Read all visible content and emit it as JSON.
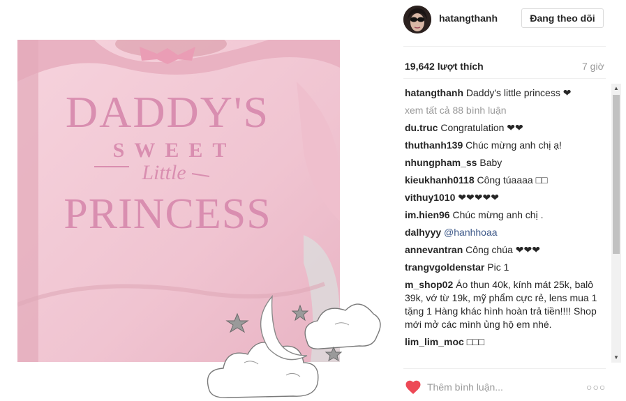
{
  "post": {
    "image_print": {
      "line1": "DADDY'S",
      "line2": "SWEET",
      "line3": "Little",
      "line4": "PRINCESS"
    }
  },
  "header": {
    "username": "hatangthanh",
    "follow_label": "Đang theo dõi"
  },
  "stats": {
    "likes": "19,642 lượt thích",
    "time": "7 giờ"
  },
  "comments": {
    "caption": {
      "user": "hatangthanh",
      "text": "Daddy's little princess ❤"
    },
    "view_all": "xem tất cả 88 bình luận",
    "items": [
      {
        "user": "du.truc",
        "text": "Congratulation ❤❤"
      },
      {
        "user": "thuthanh139",
        "text": "Chúc mừng anh chị ạ!"
      },
      {
        "user": "nhungpham_ss",
        "text": "Baby"
      },
      {
        "user": "kieukhanh0118",
        "text": "Công túaaaa □□"
      },
      {
        "user": "vithuy1010",
        "text": "❤❤❤❤❤"
      },
      {
        "user": "im.hien96",
        "text": "Chúc mừng anh chị ."
      },
      {
        "user": "dalhyyy",
        "text": "@hanhhoaa"
      },
      {
        "user": "annevantran",
        "text": "Công chúa ❤❤❤"
      },
      {
        "user": "trangvgoldenstar",
        "text": "Pic 1"
      },
      {
        "user": "m_shop02",
        "text": "Áo thun 40k, kính mát 25k, balô 39k, vớ từ 19k, mỹ phẩm cực rẻ, lens mua 1 tặng 1 Hàng khác hình hoàn trả tiền!!!! Shop mới mở các mình ủng hộ em nhé."
      },
      {
        "user": "lim_lim_moc",
        "text": "□□□"
      }
    ]
  },
  "footer": {
    "comment_placeholder": "Thêm bình luận...",
    "more_label": "○○○"
  },
  "colors": {
    "heart": "#ed4956",
    "shirt_pink": "#f4c9d6",
    "print_pink": "#d98eb0"
  }
}
